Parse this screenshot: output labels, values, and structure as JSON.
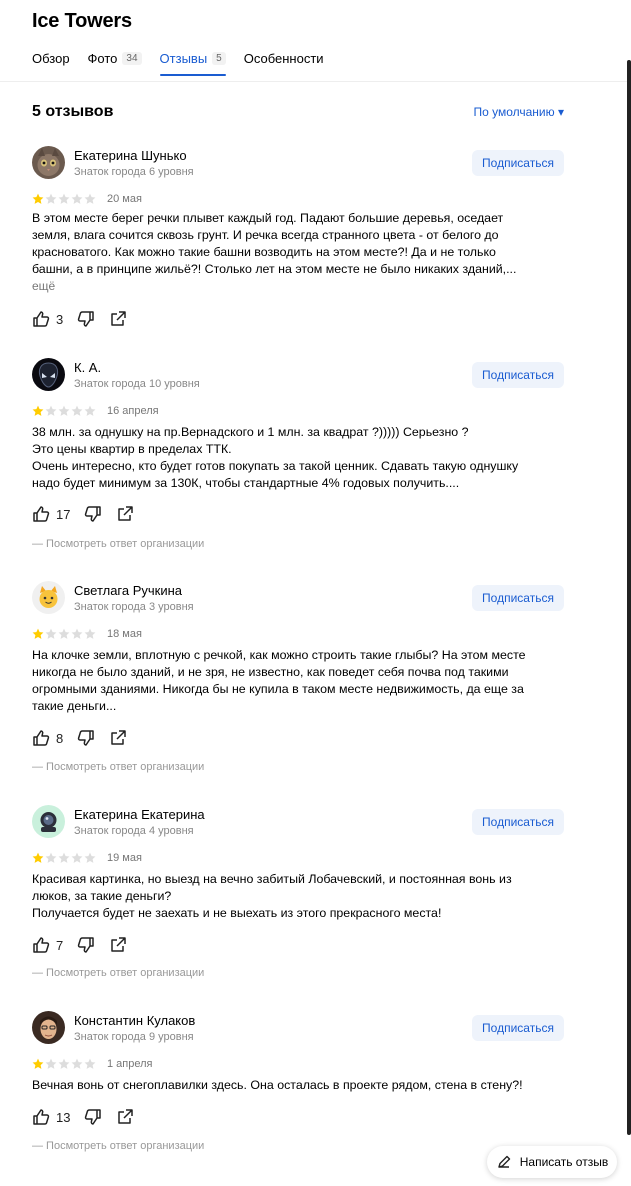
{
  "header": {
    "title": "Ice Towers",
    "tabs": [
      {
        "label": "Обзор",
        "count": ""
      },
      {
        "label": "Фото",
        "count": "34"
      },
      {
        "label": "Отзывы",
        "count": "5"
      },
      {
        "label": "Особенности",
        "count": ""
      }
    ]
  },
  "reviews_header": {
    "count_label": "5 отзывов",
    "sort_label": "По умолчанию ▾"
  },
  "subscribe_label": "Подписаться",
  "org_reply_label": "— Посмотреть ответ организации",
  "more_label": "ещё",
  "rating": {
    "value": 1,
    "max": 5
  },
  "colors": {
    "accent": "#1a5cd1",
    "star_filled": "#fc0",
    "star_empty": "#ddd"
  },
  "reviews": [
    {
      "author": "Екатерина Шунько",
      "level": "Знаток города 6 уровня",
      "date": "20 мая",
      "lines": [
        "В этом месте берег речки плывет каждый год. Падают большие деревья, оседает",
        "земля, влага сочится сквозь грунт. И речка всегда странного цвета - от белого до",
        "красноватого. Как можно такие башни возводить на этом месте?! Да и не только",
        "башни, а в принципе жильё?! Столько лет на этом месте не было никаких зданий,..."
      ],
      "likes": "3",
      "avatar_icon": "cat-photo-avatar"
    },
    {
      "author": "К. А.",
      "level": "Знаток города 10 уровня",
      "date": "16 апреля",
      "lines": [
        "38 млн. за однушку на пр.Вернадского и 1 млн. за квадрат ?))))) Серьезно ?",
        "Это цены квартир в пределах ТТК.",
        "Очень интересно, кто будет готов покупать за такой ценник. Сдавать такую однушку",
        "надо будет минимум за 130К, чтобы стандартные 4% годовых получить...."
      ],
      "likes": "17",
      "avatar_icon": "alien-avatar"
    },
    {
      "author": "Светлага Ручкина",
      "level": "Знаток города 3 уровня",
      "date": "18 мая",
      "lines": [
        "На клочке земли, вплотную с речкой, как можно строить такие глыбы? На этом месте",
        "никогда не было зданий, и не зря, не известно, как поведет себя почва под такими",
        "огромными зданиями. Никогда бы не купила в таком месте недвижимость, да еще за",
        "такие деньги..."
      ],
      "likes": "8",
      "avatar_icon": "cat-emoji-avatar"
    },
    {
      "author": "Екатерина Екатерина",
      "level": "Знаток города 4 уровня",
      "date": "19 мая",
      "lines": [
        "Красивая картинка, но выезд на вечно забитый Лобачевский, и постоянная вонь из",
        "люков, за такие деньги?",
        "Получается будет не заехать и не выехать из этого прекрасного места!"
      ],
      "likes": "7",
      "avatar_icon": "astronaut-avatar"
    },
    {
      "author": "Константин Кулаков",
      "level": "Знаток города 9 уровня",
      "date": "1 апреля",
      "lines": [
        "Вечная вонь от снегоплавилки здесь. Она осталась в проекте рядом, стена в стену?!"
      ],
      "likes": "13",
      "avatar_icon": "person-photo-avatar"
    }
  ],
  "write_review_label": "Написать отзыв"
}
